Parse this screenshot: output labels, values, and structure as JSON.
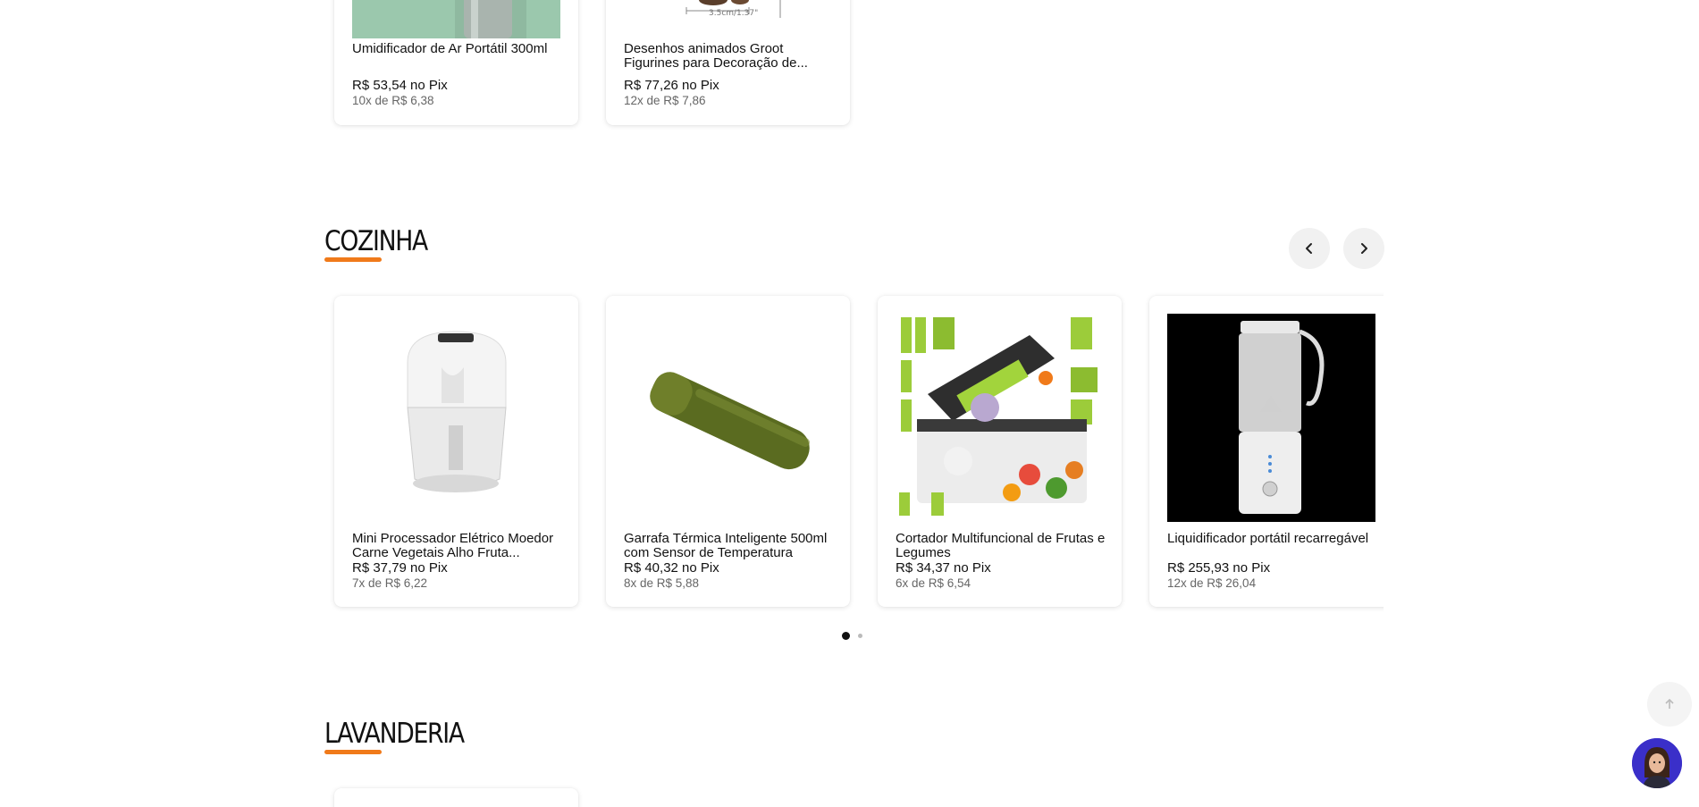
{
  "top_row": {
    "cards": [
      {
        "title": "Umidificador de Ar Portátil 300ml",
        "price": "R$ 53,54 no Pix",
        "installments": "10x de R$ 6,38"
      },
      {
        "title": "Desenhos animados Groot Figurines para Decoração de...",
        "price": "R$ 77,26 no Pix",
        "installments": "12x de R$ 7,86",
        "image_caption": "3.5cm/1.37\""
      }
    ]
  },
  "cozinha": {
    "title": "COZINHA",
    "prev_icon": "chevron-left-icon",
    "next_icon": "chevron-right-icon",
    "products": [
      {
        "title": "Mini Processador Elétrico Moedor Carne Vegetais Alho Fruta...",
        "price": "R$ 37,79 no Pix",
        "installments": "7x de R$ 6,22"
      },
      {
        "title": "Garrafa Térmica Inteligente 500ml com Sensor de Temperatura",
        "price": "R$ 40,32 no Pix",
        "installments": "8x de R$ 5,88"
      },
      {
        "title": "Cortador Multifuncional de Frutas e Legumes",
        "price": "R$ 34,37 no Pix",
        "installments": "6x de R$ 6,54"
      },
      {
        "title": "Liquidificador portátil recarregável",
        "price": "R$ 255,93 no Pix",
        "installments": "12x de R$ 26,04"
      }
    ],
    "pagination": {
      "pages": 2,
      "current": 1
    }
  },
  "lavanderia": {
    "title": "LAVANDERIA"
  },
  "colors": {
    "accent": "#f07a1a",
    "chat_bg": "#3a2fc9"
  },
  "scroll_top_icon": "arrow-up-icon",
  "chat_icon": "assistant-avatar-icon"
}
